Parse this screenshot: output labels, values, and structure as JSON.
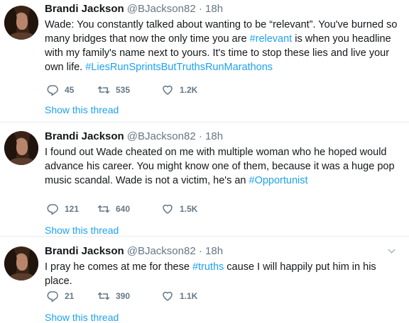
{
  "colors": {
    "link": "#1da1f2",
    "muted": "#657786",
    "text": "#14171a",
    "divider": "#e6ecf0"
  },
  "icons": {
    "reply": "reply-icon",
    "retweet": "retweet-icon",
    "like": "heart-icon",
    "more": "chevron-down-icon"
  },
  "tweets": [
    {
      "name": "Brandi Jackson",
      "handle": "@BJackson82",
      "dot": "·",
      "time": "18h",
      "text_parts": [
        "Wade: You constantly talked about wanting to be “relevant”. You've burned so many bridges that now the only time you are ",
        "#relevant",
        " is when you headline with my family's name next to yours. It's time to stop these lies and live your own life. ",
        "#LiesRunSprintsButTruthsRunMarathons"
      ],
      "replies": "45",
      "retweets": "535",
      "likes": "1.2K",
      "show_thread": "Show this thread"
    },
    {
      "name": "Brandi Jackson",
      "handle": "@BJackson82",
      "dot": "·",
      "time": "18h",
      "text_parts": [
        "I found out Wade cheated on me with multiple woman who he hoped would advance his career.  You might know one of them, because it was a huge pop music scandal.  Wade is not a victim, he's an ",
        "#Opportunist"
      ],
      "replies": "121",
      "retweets": "640",
      "likes": "1.5K",
      "show_thread": "Show this thread"
    },
    {
      "name": "Brandi Jackson",
      "handle": "@BJackson82",
      "dot": "·",
      "time": "18h",
      "text_parts": [
        "I pray he comes at me for these ",
        "#truths",
        " cause I will happily put him in his place."
      ],
      "replies": "21",
      "retweets": "390",
      "likes": "1.1K",
      "show_thread": "Show this thread"
    }
  ]
}
